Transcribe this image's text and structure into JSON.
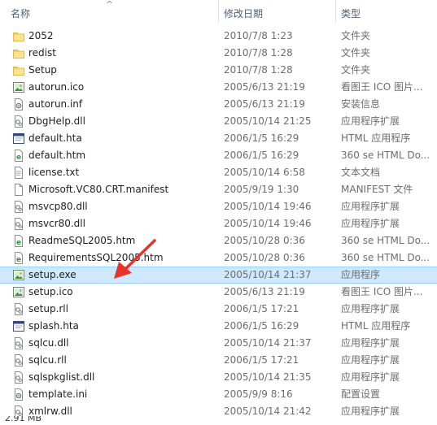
{
  "columns": {
    "name": "名称",
    "date": "修改日期",
    "type": "类型"
  },
  "sort_indicator": "^",
  "files": [
    {
      "name": "2052",
      "date": "2010/7/8 1:23",
      "type": "文件夹",
      "icon": "folder-icon"
    },
    {
      "name": "redist",
      "date": "2010/7/8 1:28",
      "type": "文件夹",
      "icon": "folder-icon"
    },
    {
      "name": "Setup",
      "date": "2010/7/8 1:28",
      "type": "文件夹",
      "icon": "folder-icon"
    },
    {
      "name": "autorun.ico",
      "date": "2005/6/13 21:19",
      "type": "看图王 ICO 图片...",
      "icon": "image-icon"
    },
    {
      "name": "autorun.inf",
      "date": "2005/6/13 21:19",
      "type": "安装信息",
      "icon": "settings-file-icon"
    },
    {
      "name": "DbgHelp.dll",
      "date": "2005/10/14 21:25",
      "type": "应用程序扩展",
      "icon": "dll-file-icon"
    },
    {
      "name": "default.hta",
      "date": "2006/1/5 16:29",
      "type": "HTML 应用程序",
      "icon": "hta-file-icon"
    },
    {
      "name": "default.htm",
      "date": "2006/1/5 16:29",
      "type": "360 se HTML Do...",
      "icon": "html-file-icon"
    },
    {
      "name": "license.txt",
      "date": "2005/10/14 6:58",
      "type": "文本文档",
      "icon": "text-file-icon"
    },
    {
      "name": "Microsoft.VC80.CRT.manifest",
      "date": "2005/9/19 1:30",
      "type": "MANIFEST 文件",
      "icon": "blank-file-icon"
    },
    {
      "name": "msvcp80.dll",
      "date": "2005/10/14 19:46",
      "type": "应用程序扩展",
      "icon": "dll-file-icon"
    },
    {
      "name": "msvcr80.dll",
      "date": "2005/10/14 19:46",
      "type": "应用程序扩展",
      "icon": "dll-file-icon"
    },
    {
      "name": "ReadmeSQL2005.htm",
      "date": "2005/10/28 0:36",
      "type": "360 se HTML Do...",
      "icon": "html-file-icon"
    },
    {
      "name": "RequirementsSQL2005.htm",
      "date": "2005/10/28 0:36",
      "type": "360 se HTML Do...",
      "icon": "html-file-icon"
    },
    {
      "name": "setup.exe",
      "date": "2005/10/14 21:37",
      "type": "应用程序",
      "icon": "exe-file-icon",
      "selected": true
    },
    {
      "name": "setup.ico",
      "date": "2005/6/13 21:19",
      "type": "看图王 ICO 图片...",
      "icon": "image-icon"
    },
    {
      "name": "setup.rll",
      "date": "2006/1/5 17:21",
      "type": "应用程序扩展",
      "icon": "dll-file-icon"
    },
    {
      "name": "splash.hta",
      "date": "2006/1/5 16:29",
      "type": "HTML 应用程序",
      "icon": "hta-file-icon"
    },
    {
      "name": "sqlcu.dll",
      "date": "2005/10/14 21:37",
      "type": "应用程序扩展",
      "icon": "dll-file-icon"
    },
    {
      "name": "sqlcu.rll",
      "date": "2006/1/5 17:21",
      "type": "应用程序扩展",
      "icon": "dll-file-icon"
    },
    {
      "name": "sqlspkglist.dll",
      "date": "2005/10/14 21:35",
      "type": "应用程序扩展",
      "icon": "dll-file-icon"
    },
    {
      "name": "template.ini",
      "date": "2005/9/9 8:16",
      "type": "配置设置",
      "icon": "settings-file-icon"
    },
    {
      "name": "xmlrw.dll",
      "date": "2005/10/14 21:42",
      "type": "应用程序扩展",
      "icon": "dll-file-icon"
    }
  ],
  "status_bar": {
    "size_text": "2.91 MB"
  },
  "colors": {
    "selection": "#cde8ff",
    "selection_border": "#99d1ff",
    "arrow": "#e8332a"
  }
}
